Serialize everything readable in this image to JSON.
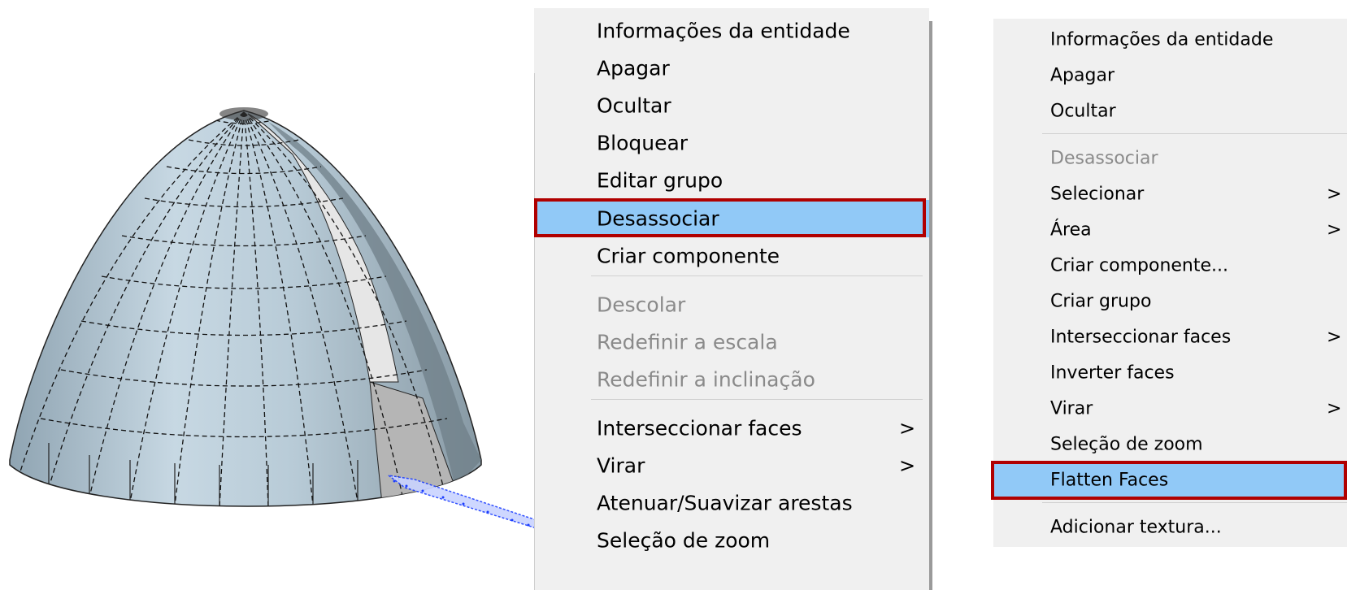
{
  "menu_left": {
    "items": [
      {
        "label": "Informações da entidade"
      },
      {
        "label": "Apagar"
      },
      {
        "label": "Ocultar"
      },
      {
        "label": "Bloquear"
      },
      {
        "label": "Editar grupo"
      },
      {
        "label": "Desassociar",
        "highlighted": true
      },
      {
        "label": "Criar componente"
      },
      {
        "label": "Descolar",
        "disabled": true
      },
      {
        "label": "Redefinir a escala",
        "disabled": true
      },
      {
        "label": "Redefinir a inclinação",
        "disabled": true
      },
      {
        "label": "Interseccionar faces",
        "submenu": true
      },
      {
        "label": "Virar",
        "submenu": true
      },
      {
        "label": "Atenuar/Suavizar arestas"
      },
      {
        "label": "Seleção de zoom"
      }
    ],
    "submenu_arrow": ">"
  },
  "menu_right": {
    "items": [
      {
        "label": "Informações da entidade"
      },
      {
        "label": "Apagar"
      },
      {
        "label": "Ocultar"
      },
      {
        "label": "Desassociar",
        "disabled": true
      },
      {
        "label": "Selecionar",
        "submenu": true
      },
      {
        "label": "Área",
        "submenu": true
      },
      {
        "label": "Criar componente..."
      },
      {
        "label": "Criar grupo"
      },
      {
        "label": "Interseccionar faces",
        "submenu": true
      },
      {
        "label": "Inverter faces"
      },
      {
        "label": "Virar",
        "submenu": true
      },
      {
        "label": "Seleção de zoom"
      },
      {
        "label": "Flatten Faces",
        "highlighted": true
      },
      {
        "label": "Adicionar textura..."
      }
    ],
    "submenu_arrow": ">"
  },
  "colors": {
    "menu_bg": "#f0f0f0",
    "highlight_bg": "#91c9f7",
    "highlight_border": "#b00000",
    "disabled_text": "#8a8a8a",
    "dome_fill": "#b9cdd9",
    "dome_dark": "#6f7f88",
    "selection_blue": "#1a3cff"
  }
}
